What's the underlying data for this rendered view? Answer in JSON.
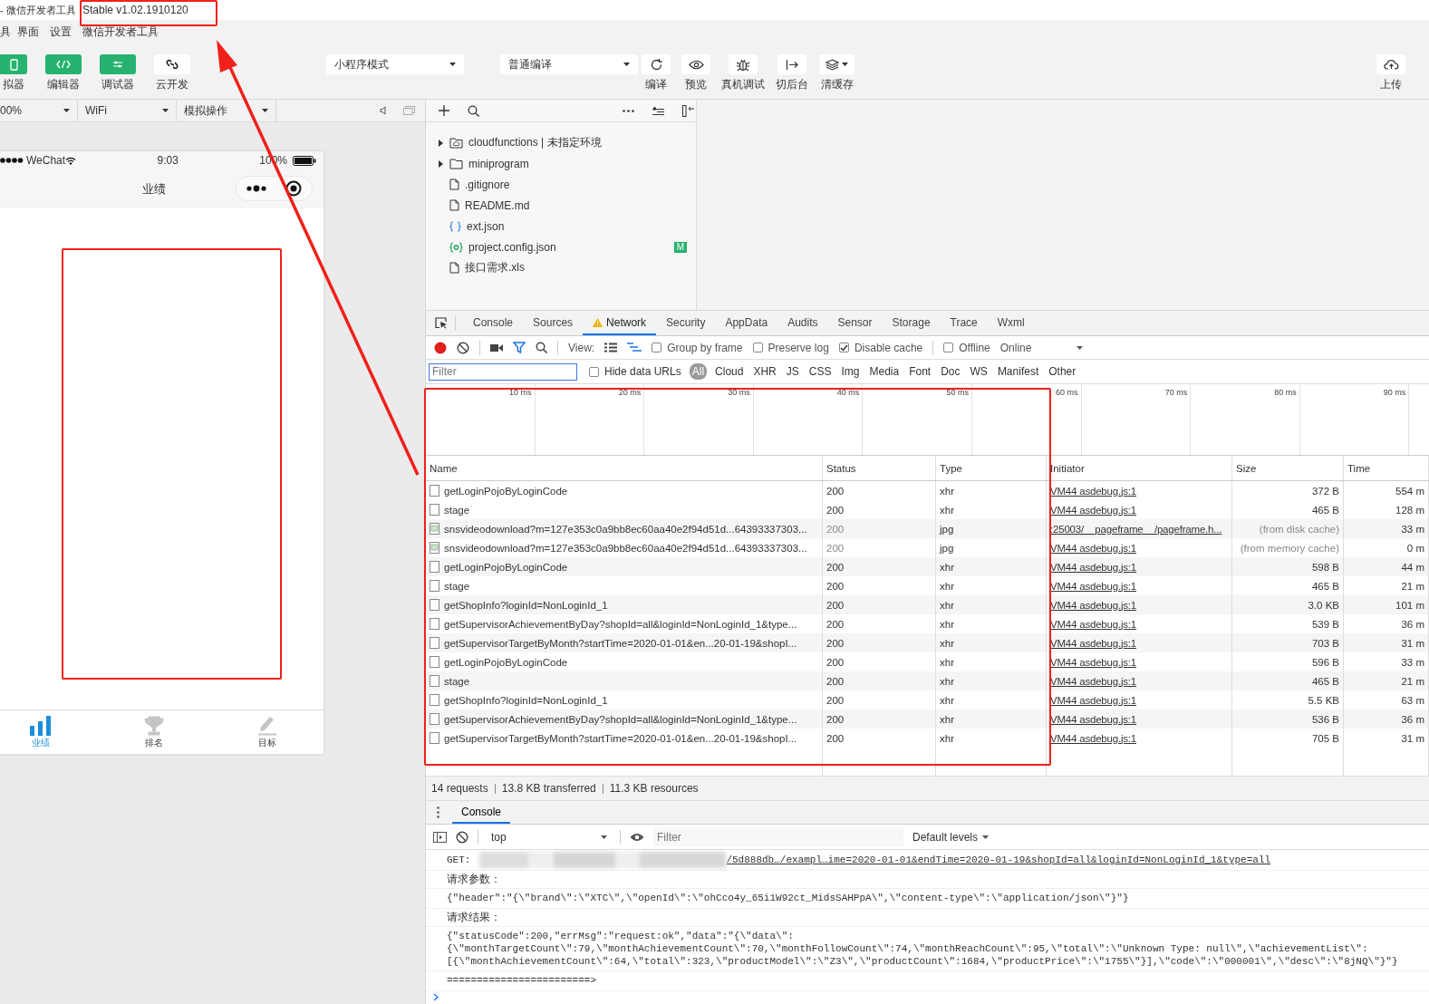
{
  "window": {
    "title_app": "- 微信开发者工具",
    "title_version": "Stable v1.02.1910120"
  },
  "menu": [
    "具",
    "界面",
    "设置",
    "微信开发者工具"
  ],
  "mode_buttons": [
    {
      "label": "拟器",
      "on": true
    },
    {
      "label": "编辑器",
      "on": true
    },
    {
      "label": "调试器",
      "on": true
    },
    {
      "label": "云开发",
      "on": false
    }
  ],
  "mode_select": "小程序模式",
  "compile_select": "普通编译",
  "tools": [
    {
      "label": "编译"
    },
    {
      "label": "预览"
    },
    {
      "label": "真机调试"
    },
    {
      "label": "切后台"
    },
    {
      "label": "清缓存"
    }
  ],
  "upload": {
    "label": "上传"
  },
  "simulator_bar": {
    "zoom": "00%",
    "network": "WiFi",
    "action": "模拟操作"
  },
  "phone": {
    "carrier": "WeChat",
    "time": "9:03",
    "battery": "100%",
    "page_title": "业绩",
    "tabs": [
      {
        "label": "业绩",
        "selected": true
      },
      {
        "label": "排名",
        "selected": false
      },
      {
        "label": "目标",
        "selected": false
      }
    ]
  },
  "file_tree": [
    {
      "name": "cloudfunctions | 未指定环境",
      "kind": "cloud-folder",
      "expanded": false
    },
    {
      "name": "miniprogram",
      "kind": "folder",
      "expanded": false
    },
    {
      "name": ".gitignore",
      "kind": "file"
    },
    {
      "name": "README.md",
      "kind": "file"
    },
    {
      "name": "ext.json",
      "kind": "json"
    },
    {
      "name": "project.config.json",
      "kind": "config",
      "badge": "M"
    },
    {
      "name": "接口需求.xls",
      "kind": "file"
    }
  ],
  "devtools": {
    "tabs": [
      {
        "label": "Console",
        "selected": false,
        "warning": false
      },
      {
        "label": "Sources",
        "selected": false,
        "warning": false
      },
      {
        "label": "Network",
        "selected": true,
        "warning": true
      },
      {
        "label": "Security",
        "selected": false,
        "warning": false
      },
      {
        "label": "AppData",
        "selected": false,
        "warning": false
      },
      {
        "label": "Audits",
        "selected": false,
        "warning": false
      },
      {
        "label": "Sensor",
        "selected": false,
        "warning": false
      },
      {
        "label": "Storage",
        "selected": false,
        "warning": false
      },
      {
        "label": "Trace",
        "selected": false,
        "warning": false
      },
      {
        "label": "Wxml",
        "selected": false,
        "warning": false
      }
    ],
    "view_label": "View:",
    "options": [
      {
        "label": "Group by frame",
        "checked": false
      },
      {
        "label": "Preserve log",
        "checked": false
      },
      {
        "label": "Disable cache",
        "checked": true
      },
      {
        "label": "Offline",
        "checked": false
      }
    ],
    "throttle": "Online",
    "filter": {
      "placeholder": "Filter",
      "hide_data_urls": {
        "label": "Hide data URLs",
        "checked": false
      },
      "types": [
        {
          "label": "All",
          "selected": true
        },
        {
          "label": "Cloud",
          "selected": false
        },
        {
          "label": "XHR",
          "selected": false
        },
        {
          "label": "JS",
          "selected": false
        },
        {
          "label": "CSS",
          "selected": false
        },
        {
          "label": "Img",
          "selected": false
        },
        {
          "label": "Media",
          "selected": false
        },
        {
          "label": "Font",
          "selected": false
        },
        {
          "label": "Doc",
          "selected": false
        },
        {
          "label": "WS",
          "selected": false
        },
        {
          "label": "Manifest",
          "selected": false
        },
        {
          "label": "Other",
          "selected": false
        }
      ]
    },
    "timeline_ticks": [
      "10 ms",
      "20 ms",
      "30 ms",
      "40 ms",
      "50 ms",
      "60 ms",
      "70 ms",
      "80 ms",
      "90 ms"
    ],
    "columns": [
      "Name",
      "Status",
      "Type",
      "Initiator",
      "Size",
      "Time"
    ],
    "rows": [
      {
        "kind": "doc",
        "name": "getLoginPojoByLoginCode",
        "status": "200",
        "cached": false,
        "type": "xhr",
        "initiator": "VM44 asdebug.js:1",
        "size": "372 B",
        "time": "554 m"
      },
      {
        "kind": "doc",
        "name": "stage",
        "status": "200",
        "cached": false,
        "type": "xhr",
        "initiator": "VM44 asdebug.js:1",
        "size": "465 B",
        "time": "128 m"
      },
      {
        "kind": "image",
        "name": "snsvideodownload?m=127e353c0a9bb8ec60aa40e2f94d51d...64393337303...",
        "status": "200",
        "cached": true,
        "type": "jpg",
        "initiator": ":25003/__pageframe__/pageframe.h...",
        "size": "(from disk cache)",
        "time": "33 m"
      },
      {
        "kind": "image",
        "name": "snsvideodownload?m=127e353c0a9bb8ec60aa40e2f94d51d...64393337303...",
        "status": "200",
        "cached": true,
        "type": "jpg",
        "initiator": "VM44 asdebug.js:1",
        "size": "(from memory cache)",
        "time": "0 m"
      },
      {
        "kind": "doc",
        "name": "getLoginPojoByLoginCode",
        "status": "200",
        "cached": false,
        "type": "xhr",
        "initiator": "VM44 asdebug.js:1",
        "size": "598 B",
        "time": "44 m"
      },
      {
        "kind": "doc",
        "name": "stage",
        "status": "200",
        "cached": false,
        "type": "xhr",
        "initiator": "VM44 asdebug.js:1",
        "size": "465 B",
        "time": "21 m"
      },
      {
        "kind": "doc",
        "name": "getShopInfo?loginId=NonLoginId_1",
        "status": "200",
        "cached": false,
        "type": "xhr",
        "initiator": "VM44 asdebug.js:1",
        "size": "3.0 KB",
        "time": "101 m"
      },
      {
        "kind": "doc",
        "name": "getSupervisorAchievementByDay?shopId=all&loginId=NonLoginId_1&type...",
        "status": "200",
        "cached": false,
        "type": "xhr",
        "initiator": "VM44 asdebug.js:1",
        "size": "539 B",
        "time": "36 m"
      },
      {
        "kind": "doc",
        "name": "getSupervisorTargetByMonth?startTime=2020-01-01&en...20-01-19&shopI...",
        "status": "200",
        "cached": false,
        "type": "xhr",
        "initiator": "VM44 asdebug.js:1",
        "size": "703 B",
        "time": "31 m"
      },
      {
        "kind": "doc",
        "name": "getLoginPojoByLoginCode",
        "status": "200",
        "cached": false,
        "type": "xhr",
        "initiator": "VM44 asdebug.js:1",
        "size": "596 B",
        "time": "33 m"
      },
      {
        "kind": "doc",
        "name": "stage",
        "status": "200",
        "cached": false,
        "type": "xhr",
        "initiator": "VM44 asdebug.js:1",
        "size": "465 B",
        "time": "21 m"
      },
      {
        "kind": "doc",
        "name": "getShopInfo?loginId=NonLoginId_1",
        "status": "200",
        "cached": false,
        "type": "xhr",
        "initiator": "VM44 asdebug.js:1",
        "size": "5.5 KB",
        "time": "63 m"
      },
      {
        "kind": "doc",
        "name": "getSupervisorAchievementByDay?shopId=all&loginId=NonLoginId_1&type...",
        "status": "200",
        "cached": false,
        "type": "xhr",
        "initiator": "VM44 asdebug.js:1",
        "size": "536 B",
        "time": "36 m"
      },
      {
        "kind": "doc",
        "name": "getSupervisorTargetByMonth?startTime=2020-01-01&en...20-01-19&shopI...",
        "status": "200",
        "cached": false,
        "type": "xhr",
        "initiator": "VM44 asdebug.js:1",
        "size": "705 B",
        "time": "31 m"
      }
    ],
    "summary": [
      "14 requests",
      "13.8 KB transferred",
      "11.3 KB resources"
    ]
  },
  "console": {
    "tab": "Console",
    "context": "top",
    "filter_placeholder": "Filter",
    "levels": "Default levels",
    "messages": [
      {
        "kind": "request",
        "method": "GET:",
        "url": "/5d888db…/exampl…ime=2020-01-01&endTime=2020-01-19&shopId=all&loginId=NonLoginId_1&type=all"
      },
      {
        "kind": "label",
        "lines": [
          "请求参数："
        ]
      },
      {
        "kind": "code",
        "lines": [
          "{\"header\":\"{\\\"brand\\\":\\\"XTC\\\",\\\"openId\\\":\\\"ohCco4y_65i1W92ct_MidsSAHPpA\\\",\\\"content-type\\\":\\\"application/json\\\"}\"}"
        ]
      },
      {
        "kind": "label",
        "lines": [
          "请求结果："
        ]
      },
      {
        "kind": "code",
        "lines": [
          "{\"statusCode\":200,\"errMsg\":\"request:ok\",\"data\":\"{\\\"data\\\":",
          "{\\\"monthTargetCount\\\":79,\\\"monthAchievementCount\\\":70,\\\"monthFollowCount\\\":74,\\\"monthReachCount\\\":95,\\\"total\\\":\\\"Unknown Type: null\\\",\\\"achievementList\\\":",
          "[{\\\"monthAchievementCount\\\":64,\\\"total\\\":323,\\\"productModel\\\":\\\"Z3\\\",\\\"productCount\\\":1684,\\\"productPrice\\\":\\\"1755\\\"}],\\\"code\\\":\\\"000001\\\",\\\"desc\\\":\\\"8jNQ\\\"}\"}"
        ]
      },
      {
        "kind": "code",
        "lines": [
          "========================>"
        ]
      }
    ]
  }
}
